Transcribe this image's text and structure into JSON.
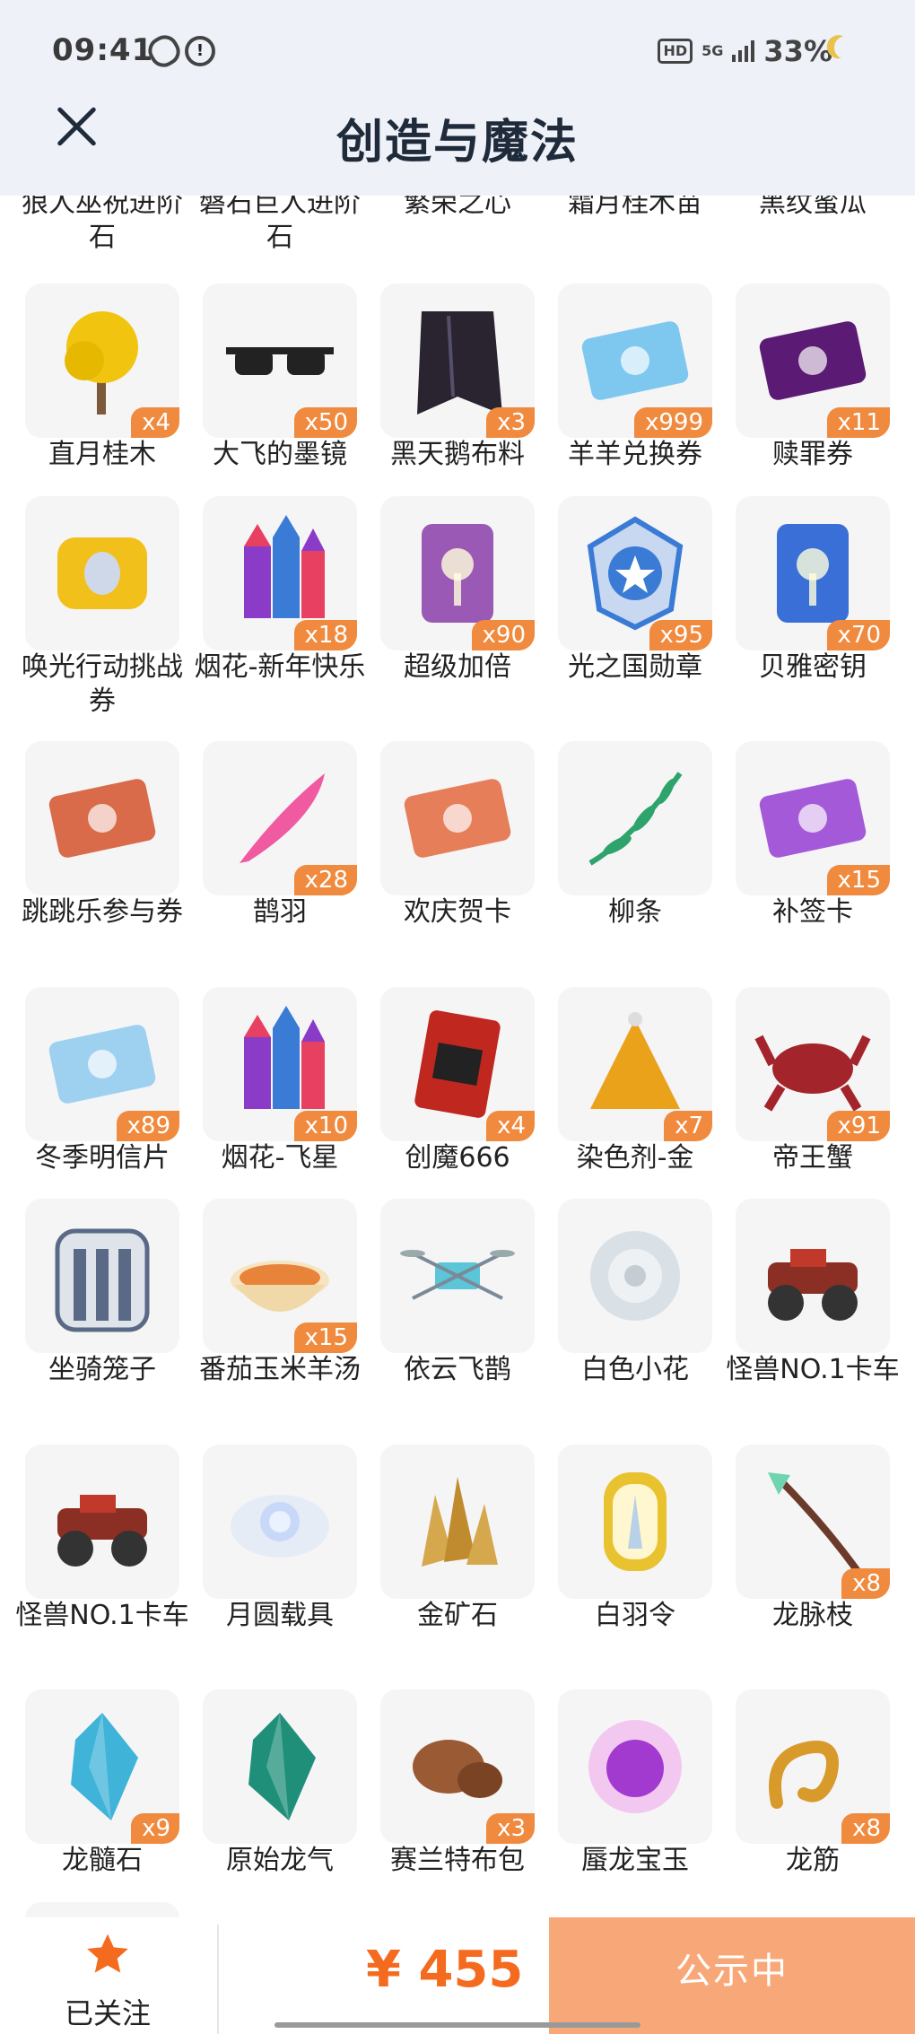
{
  "status": {
    "time": "09:41",
    "hd": "HD",
    "network": "5G",
    "battery": "33%"
  },
  "header": {
    "title": "创造与魔法"
  },
  "prev_row": [
    "狼人巫祝进阶石",
    "磐石巨人进阶石",
    "繁荣之心",
    "霜月桂木苗",
    "黑纹蜜瓜"
  ],
  "items": [
    {
      "name": "直月桂木",
      "qty": "x4",
      "icon": "yellow-tree-icon",
      "color": "#f1c40f"
    },
    {
      "name": "大飞的墨镜",
      "qty": "x50",
      "icon": "sunglasses-icon",
      "color": "#222222"
    },
    {
      "name": "黑天鹅布料",
      "qty": "x3",
      "icon": "black-cloth-icon",
      "color": "#2a2430"
    },
    {
      "name": "羊羊兑换券",
      "qty": "x999",
      "icon": "sheep-ticket-icon",
      "color": "#7ec8f0"
    },
    {
      "name": "赎罪券",
      "qty": "x11",
      "icon": "purple-ticket-icon",
      "color": "#5b1a73"
    },
    {
      "name": "唤光行动挑战券",
      "qty": "",
      "icon": "golden-scroll-icon",
      "color": "#f2c01a"
    },
    {
      "name": "烟花-新年快乐",
      "qty": "x18",
      "icon": "fireworks-icon",
      "color": "#8a3cc8"
    },
    {
      "name": "超级加倍",
      "qty": "x90",
      "icon": "double-card-icon",
      "color": "#9b59b6"
    },
    {
      "name": "光之国勋章",
      "qty": "x95",
      "icon": "medal-icon",
      "color": "#3a7bd5"
    },
    {
      "name": "贝雅密钥",
      "qty": "x70",
      "icon": "key-card-icon",
      "color": "#3b6fd8"
    },
    {
      "name": "跳跳乐参与券",
      "qty": "",
      "icon": "red-ticket-icon",
      "color": "#d96a4a"
    },
    {
      "name": "鹊羽",
      "qty": "x28",
      "icon": "pink-feather-icon",
      "color": "#ef5aa0"
    },
    {
      "name": "欢庆贺卡",
      "qty": "",
      "icon": "greeting-card-icon",
      "color": "#e67e5a"
    },
    {
      "name": "柳条",
      "qty": "",
      "icon": "willow-branch-icon",
      "color": "#2ea36b"
    },
    {
      "name": "补签卡",
      "qty": "x15",
      "icon": "makeup-card-icon",
      "color": "#a45ad8"
    },
    {
      "name": "冬季明信片",
      "qty": "x89",
      "icon": "winter-postcard-icon",
      "color": "#9ed0ef"
    },
    {
      "name": "烟花-飞星",
      "qty": "x10",
      "icon": "fireworks-icon",
      "color": "#8a3cc8"
    },
    {
      "name": "创魔666",
      "qty": "x4",
      "icon": "red-card-666-icon",
      "color": "#c0271f"
    },
    {
      "name": "染色剂-金",
      "qty": "x7",
      "icon": "gold-dye-icon",
      "color": "#e9a21a"
    },
    {
      "name": "帝王蟹",
      "qty": "x91",
      "icon": "king-crab-icon",
      "color": "#a4242b"
    },
    {
      "name": "坐骑笼子",
      "qty": "",
      "icon": "mount-cage-icon",
      "color": "#5a6a86"
    },
    {
      "name": "番茄玉米羊汤",
      "qty": "x15",
      "icon": "soup-bowl-icon",
      "color": "#e8833a"
    },
    {
      "name": "依云飞鹊",
      "qty": "",
      "icon": "drone-icon",
      "color": "#5cc6d8"
    },
    {
      "name": "白色小花",
      "qty": "",
      "icon": "white-flower-icon",
      "color": "#d9e0e6"
    },
    {
      "name": "怪兽NO.1卡车",
      "qty": "",
      "icon": "monster-truck-icon",
      "color": "#8b2f24"
    },
    {
      "name": "怪兽NO.1卡车",
      "qty": "",
      "icon": "monster-truck-icon",
      "color": "#8b2f24"
    },
    {
      "name": "月圆载具",
      "qty": "",
      "icon": "moon-vehicle-icon",
      "color": "#c8d8f8"
    },
    {
      "name": "金矿石",
      "qty": "",
      "icon": "gold-ore-icon",
      "color": "#d6a84e"
    },
    {
      "name": "白羽令",
      "qty": "",
      "icon": "white-feather-token-icon",
      "color": "#e9c230"
    },
    {
      "name": "龙脉枝",
      "qty": "x8",
      "icon": "dragon-branch-icon",
      "color": "#6b3a2b"
    },
    {
      "name": "龙髓石",
      "qty": "x9",
      "icon": "blue-crystal-icon",
      "color": "#3fb3d8"
    },
    {
      "name": "原始龙气",
      "qty": "",
      "icon": "green-crystal-icon",
      "color": "#1f8f7a"
    },
    {
      "name": "赛兰特布包",
      "qty": "x3",
      "icon": "cloth-bag-icon",
      "color": "#9a5a33"
    },
    {
      "name": "蜃龙宝玉",
      "qty": "",
      "icon": "purple-orb-icon",
      "color": "#a23ad0"
    },
    {
      "name": "龙筋",
      "qty": "x8",
      "icon": "golden-tendon-icon",
      "color": "#d89a2a"
    }
  ],
  "bottom": {
    "follow_label": "已关注",
    "price": "¥ 455",
    "status_button": "公示中"
  },
  "colors": {
    "accent": "#f08a3e",
    "price": "#f46a1e",
    "button": "#f8a878"
  }
}
